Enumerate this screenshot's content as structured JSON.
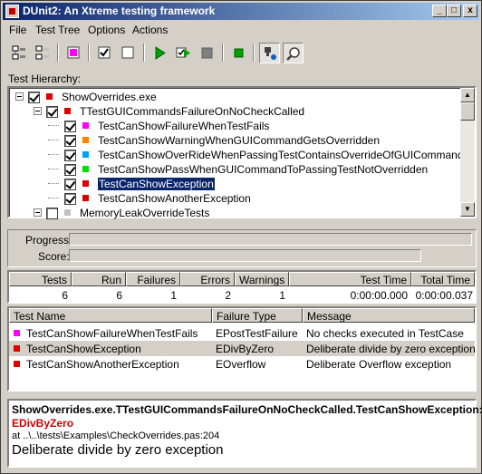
{
  "window": {
    "title": "DUnit2: An Xtreme testing framework",
    "min_btn": "_",
    "max_btn": "□",
    "close_btn": "x"
  },
  "menu": [
    "File",
    "Test Tree",
    "Options",
    "Actions"
  ],
  "toolbar": {
    "icons": [
      "select-all-icon",
      "deselect-all-icon",
      "select-failed-icon",
      "check-icon",
      "uncheck-icon",
      "run-icon",
      "run-selected-icon",
      "stop-icon",
      "run-current-icon",
      "break-on-failure-icon",
      "find-icon"
    ]
  },
  "hierarchy": {
    "label": "Test Hierarchy:",
    "rows": [
      {
        "text": "ShowOverrides.exe",
        "color": "#e00000",
        "checked": true,
        "level": 0,
        "expandable": true,
        "selected": false
      },
      {
        "text": "TTestGUICommandsFailureOnNoCheckCalled",
        "color": "#e00000",
        "checked": true,
        "level": 1,
        "expandable": true,
        "selected": false
      },
      {
        "text": "TestCanShowFailureWhenTestFails",
        "color": "#ff00ff",
        "checked": true,
        "level": 2,
        "expandable": false,
        "selected": false
      },
      {
        "text": "TestCanShowWarningWhenGUICommandGetsOverridden",
        "color": "#ff8000",
        "checked": true,
        "level": 2,
        "expandable": false,
        "selected": false
      },
      {
        "text": "TestCanShowOverRideWhenPassingTestContainsOverrideOfGUICommand",
        "color": "#00a0ff",
        "checked": true,
        "level": 2,
        "expandable": false,
        "selected": false
      },
      {
        "text": "TestCanShowPassWhenGUICommandToPassingTestNotOverridden",
        "color": "#00e000",
        "checked": true,
        "level": 2,
        "expandable": false,
        "selected": false
      },
      {
        "text": "TestCanShowException",
        "color": "#e00000",
        "checked": true,
        "level": 2,
        "expandable": false,
        "selected": true
      },
      {
        "text": "TestCanShowAnotherException",
        "color": "#e00000",
        "checked": true,
        "level": 2,
        "expandable": false,
        "selected": false
      },
      {
        "text": "MemoryLeakOverrideTests",
        "color": "#c0c0c0",
        "checked": false,
        "level": 1,
        "expandable": true,
        "selected": false
      }
    ]
  },
  "progress": {
    "progress_label": "Progress:",
    "score_label": "Score:",
    "progress_fraction": 0,
    "score_fraction": 0
  },
  "stats": {
    "headers": [
      "Tests",
      "Run",
      "Failures",
      "Errors",
      "Warnings",
      "Test Time",
      "Total Time"
    ],
    "values": [
      "6",
      "6",
      "1",
      "2",
      "1",
      "0:00:00.000",
      "0:00:00.037"
    ]
  },
  "failures": {
    "headers": [
      "Test Name",
      "Failure Type",
      "Message"
    ],
    "rows": [
      {
        "name": "TestCanShowFailureWhenTestFails",
        "type": "EPostTestFailure",
        "message": "No checks executed in TestCase",
        "color": "#ff00ff",
        "selected": false
      },
      {
        "name": "TestCanShowException",
        "type": "EDivByZero",
        "message": "Deliberate divide by zero exception",
        "color": "#e00000",
        "selected": true
      },
      {
        "name": "TestCanShowAnotherException",
        "type": "EOverflow",
        "message": "Deliberate Overflow exception",
        "color": "#e00000",
        "selected": false
      }
    ]
  },
  "details": {
    "test_path": "ShowOverrides.exe.TTestGUICommandsFailureOnNoCheckCalled.TestCanShowException:",
    "exception": "EDivByZero",
    "location": "at ..\\..\\tests\\Examples\\CheckOverrides.pas:204",
    "message": "Deliberate divide by zero exception"
  }
}
